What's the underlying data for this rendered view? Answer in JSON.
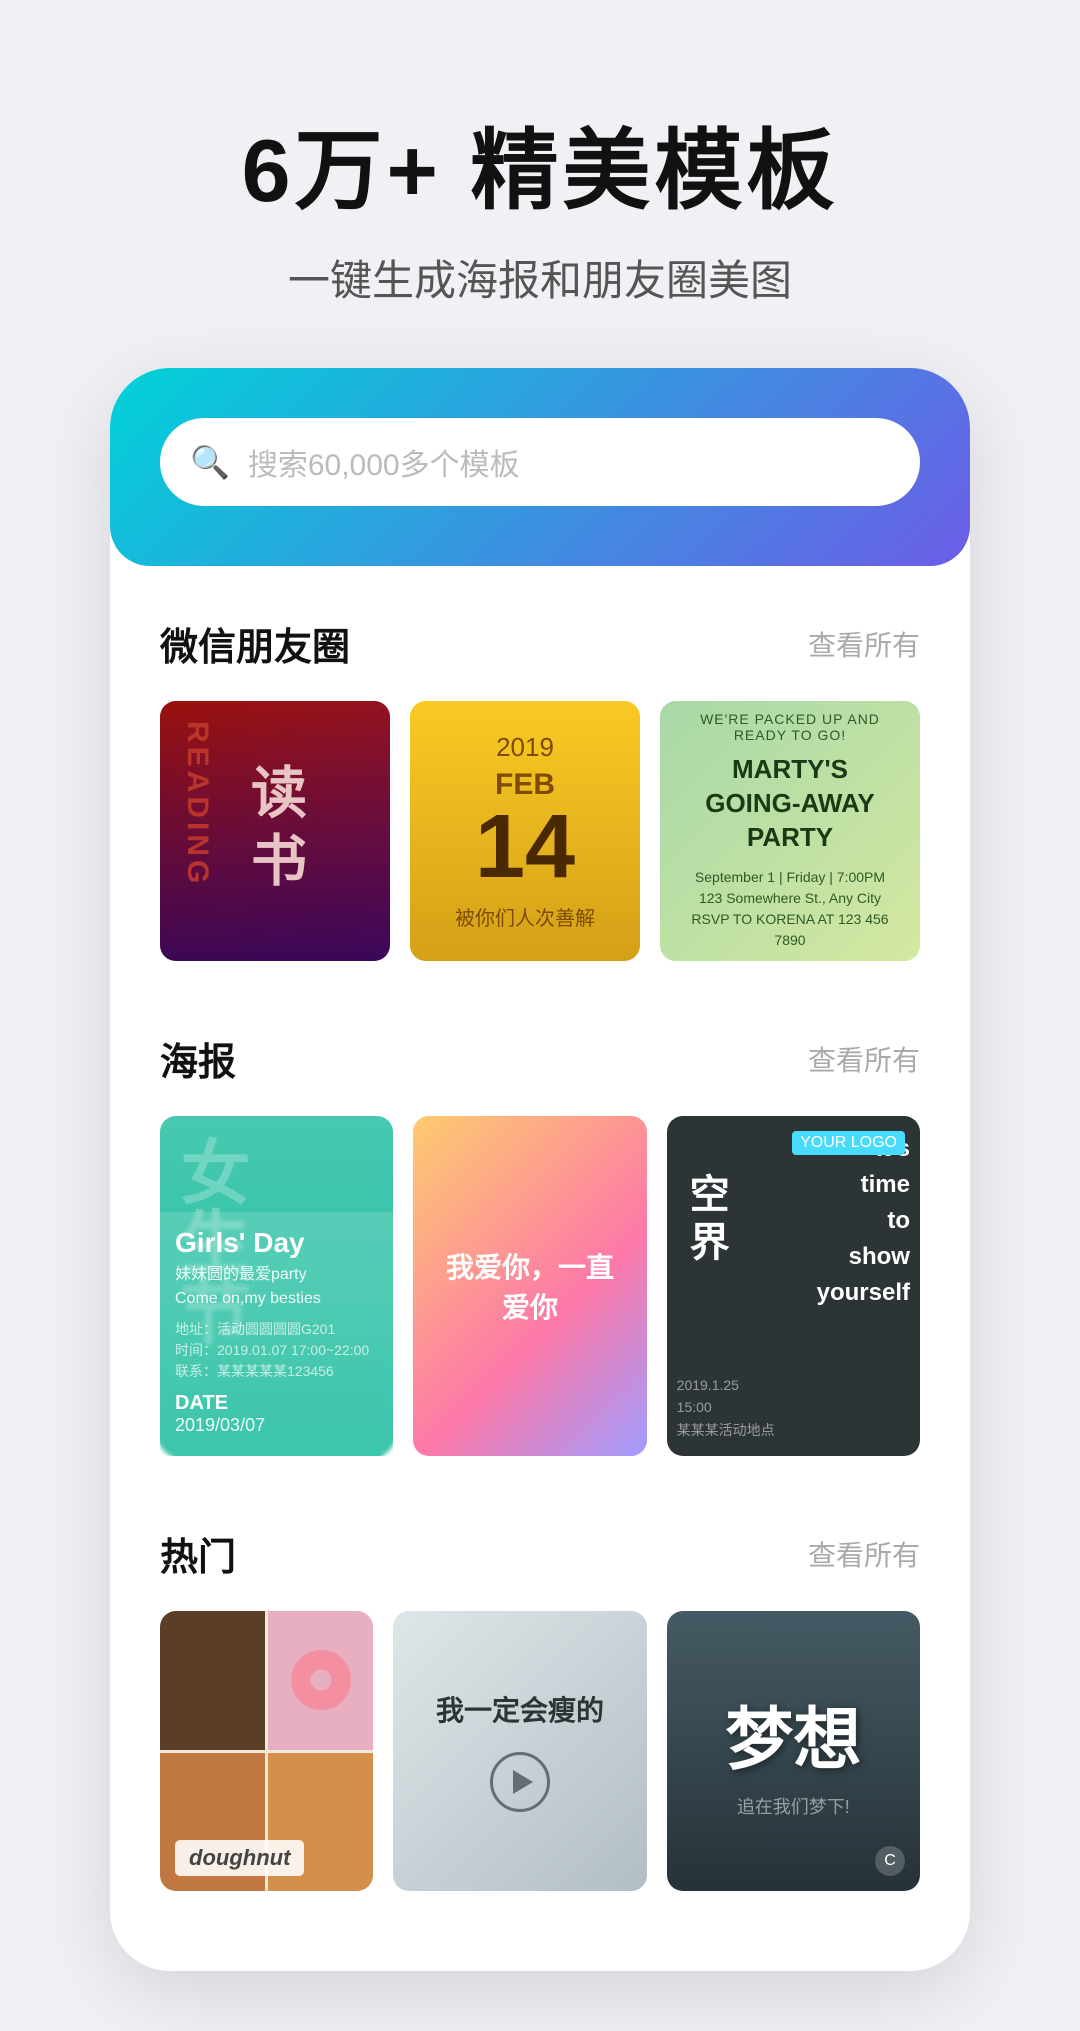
{
  "hero": {
    "title": "6万+ 精美模板",
    "subtitle": "一键生成海报和朋友圈美图"
  },
  "search": {
    "placeholder": "搜索60,000多个模板"
  },
  "sections": [
    {
      "id": "wechat",
      "title": "微信朋友圈",
      "link": "查看所有",
      "cards": [
        {
          "id": "reading",
          "type": "reading",
          "text": "读书"
        },
        {
          "id": "feb14",
          "type": "feb",
          "year": "2019",
          "month": "FEB",
          "day": "14",
          "sub": "被你们人次善解"
        },
        {
          "id": "party",
          "type": "party",
          "text": "MARTY'S\nGOING-AWAY PARTY"
        }
      ]
    },
    {
      "id": "poster",
      "title": "海报",
      "link": "查看所有",
      "cards": [
        {
          "id": "girls",
          "type": "girls",
          "main": "Girls' Day",
          "sub": "妹妹圆的最爱party\nCome on,my besties",
          "date": "DATE\n2019/03/07"
        },
        {
          "id": "love",
          "type": "love",
          "text": "我爱你，一直爱你"
        },
        {
          "id": "show",
          "type": "show",
          "text": "空界",
          "sub": "It's\ntime\nto\nshow\nyourself"
        }
      ]
    },
    {
      "id": "hot",
      "title": "热门",
      "link": "查看所有",
      "cards": [
        {
          "id": "doughnut",
          "type": "doughnut",
          "label": "doughnut"
        },
        {
          "id": "motivation",
          "type": "motivation",
          "text": "我一定会瘦的"
        },
        {
          "id": "dream",
          "type": "dream",
          "zh": "梦想",
          "sub": "追在我们梦下!"
        }
      ]
    }
  ]
}
